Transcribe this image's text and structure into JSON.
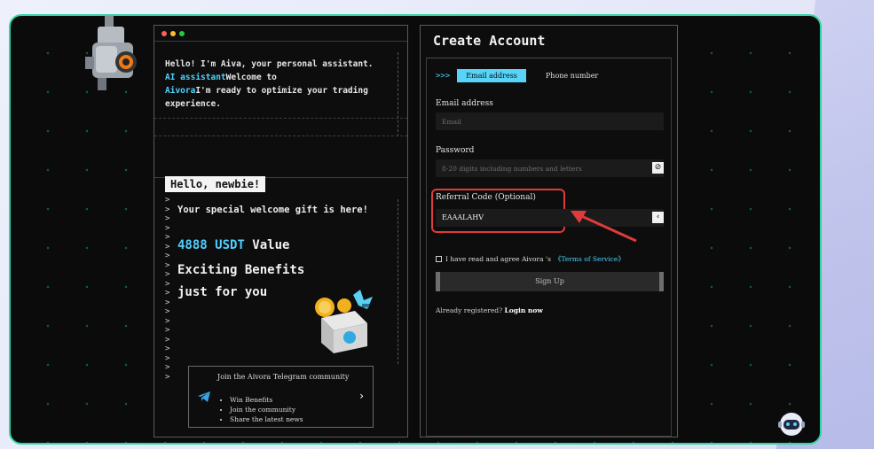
{
  "terminal": {
    "intro_1": "Hello! I'm Aiva, your personal assistant. ",
    "intro_hl1": "AI assistant",
    "intro_2": "Welcome to ",
    "intro_hl2": "Aivora",
    "intro_3": "I'm ready to optimize your trading experience.",
    "hello_tag": "Hello, newbie!",
    "gift_text": "Your special welcome gift is here!",
    "usdt_amount": "4888 USDT",
    "value_word": " Value",
    "benefits_1": "Exciting Benefits",
    "benefits_2": "just for you",
    "caret": ">",
    "telegram": {
      "title": "Join the Aivora Telegram community",
      "items": [
        "Win Benefits",
        "Join the community",
        "Share the latest news"
      ]
    }
  },
  "account": {
    "title": "Create Account",
    "tab_arrows": ">>>",
    "tab_email": "Email address",
    "tab_phone": "Phone number",
    "email_label": "Email address",
    "email_placeholder": "Email",
    "password_label": "Password",
    "password_placeholder": "8-20 digits including numbers and letters",
    "referral_label": "Referral Code (Optional)",
    "referral_value": "EAAALAHV",
    "agree_text": "I have read and agree Aivora 's ",
    "terms_text": "《Terms of Service》",
    "signup_label": "Sign Up",
    "already_text": "Already registered? ",
    "login_text": "Login now"
  },
  "colors": {
    "accent": "#4fd1ff",
    "frame_border": "#2fd6a3",
    "highlight_box": "#e03a3a"
  },
  "icons": [
    "robot-camera-icon",
    "gift-box-icon",
    "telegram-icon",
    "chevron-right-icon",
    "eye-off-icon",
    "back-icon",
    "chat-bot-icon"
  ]
}
